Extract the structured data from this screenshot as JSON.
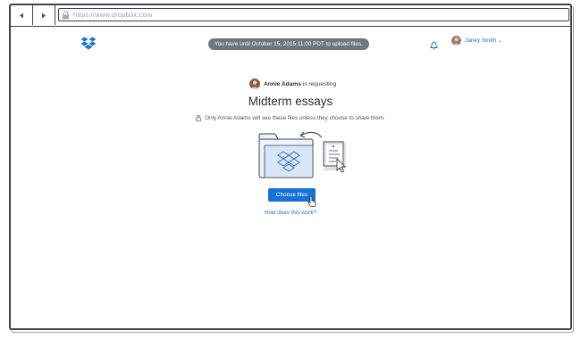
{
  "browser": {
    "url": "https://www.dropbox.com"
  },
  "header": {
    "deadline_notice": "You have until October 15, 2015 11:00 PDT to upload files.",
    "user_name": "Janey Smith",
    "user_caret": "⌄"
  },
  "request": {
    "requester_name": "Annie Adams",
    "requester_suffix": " is requesting",
    "title": "Midterm essays",
    "privacy_note": "Only Annie Adams will see these files unless they choose to share them.",
    "choose_button": "Choose files",
    "help_link": "How does this work?"
  },
  "colors": {
    "accent": "#1572d6",
    "link": "#1f6fd1",
    "pill": "#6f7682",
    "frame": "#3b4150"
  },
  "icons": [
    "back-arrow-icon",
    "forward-arrow-icon",
    "lock-icon",
    "dropbox-logo-icon",
    "bell-icon",
    "avatar",
    "folder-illustration",
    "document-icon",
    "pointer-cursor-icon"
  ]
}
